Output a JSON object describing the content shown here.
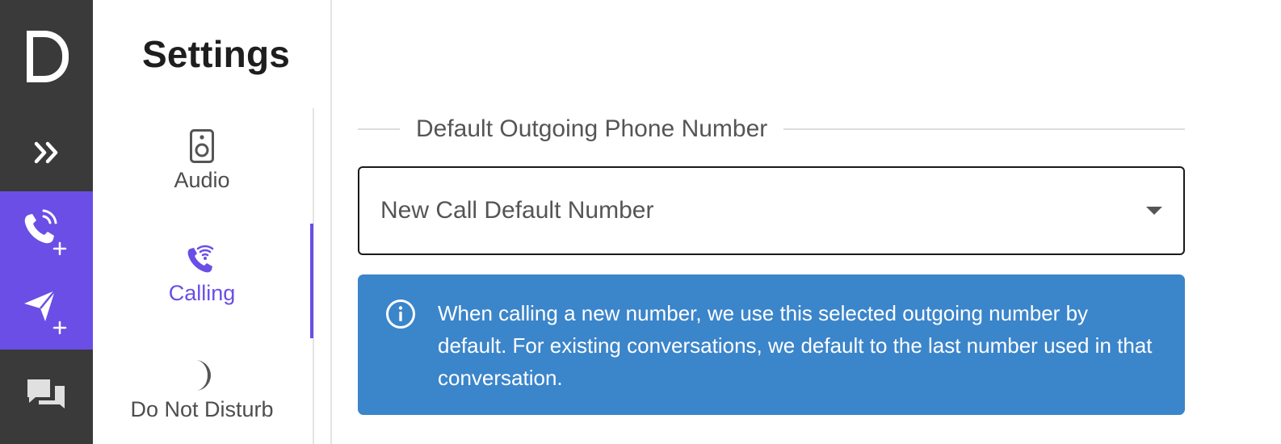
{
  "rail": {
    "logo_letter": "D",
    "items": [
      {
        "name": "expand",
        "icon": "double-chevron-right-icon"
      },
      {
        "name": "new-call",
        "icon": "phone-plus-icon"
      },
      {
        "name": "new-message",
        "icon": "send-plus-icon"
      },
      {
        "name": "conversations",
        "icon": "chat-bubbles-icon"
      }
    ],
    "colors": {
      "background": "#3a3a3a",
      "accent": "#6a4ee6"
    }
  },
  "settings_nav": {
    "title": "Settings",
    "items": [
      {
        "label": "Audio",
        "icon": "speaker-icon",
        "active": false
      },
      {
        "label": "Calling",
        "icon": "phone-wifi-icon",
        "active": true
      },
      {
        "label": "Do Not Disturb",
        "icon": "moon-icon",
        "active": false
      }
    ]
  },
  "main": {
    "section_title": "Default Outgoing Phone Number",
    "select": {
      "value": "New Call Default Number"
    },
    "info": {
      "icon": "info-icon",
      "text": "When calling a new number, we use this selected outgoing number by default. For existing conversations, we default to the last number used in that conversation.",
      "color": "#3b85ca"
    }
  }
}
